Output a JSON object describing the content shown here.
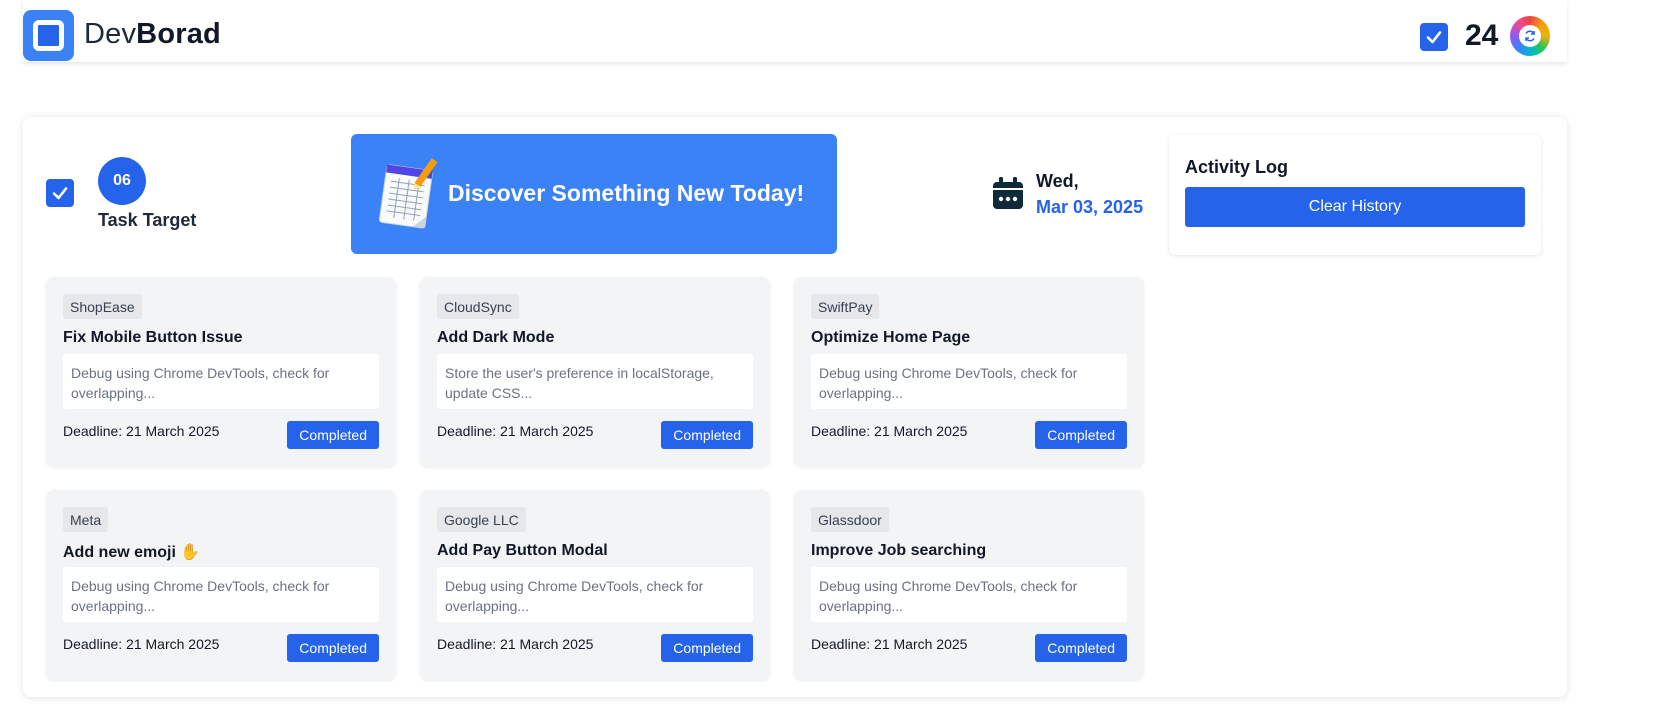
{
  "header": {
    "brand_prefix": "Dev",
    "brand_bold": "Borad",
    "completed_count": "24"
  },
  "task_target": {
    "count": "06",
    "label": "Task Target"
  },
  "banner": {
    "text": "Discover Something New Today!"
  },
  "date": {
    "day": "Wed,",
    "full": "Mar 03, 2025"
  },
  "activity_log": {
    "title": "Activity Log",
    "clear_label": "Clear History"
  },
  "cards": [
    {
      "company": "ShopEase",
      "title": "Fix Mobile Button Issue",
      "description": "Debug using Chrome DevTools, check for overlapping...",
      "deadline": "Deadline: 21 March 2025",
      "status": "Completed"
    },
    {
      "company": "CloudSync",
      "title": "Add Dark Mode",
      "description": "Store the user's preference in localStorage, update CSS...",
      "deadline": "Deadline: 21 March 2025",
      "status": "Completed"
    },
    {
      "company": "SwiftPay",
      "title": "Optimize Home Page",
      "description": "Debug using Chrome DevTools, check for overlapping...",
      "deadline": "Deadline: 21 March 2025",
      "status": "Completed"
    },
    {
      "company": "Meta",
      "title": "Add new emoji ✋",
      "description": "Debug using Chrome DevTools, check for overlapping...",
      "deadline": "Deadline: 21 March 2025",
      "status": "Completed"
    },
    {
      "company": "Google LLC",
      "title": "Add Pay Button Modal",
      "description": "Debug using Chrome DevTools, check for overlapping...",
      "deadline": "Deadline: 21 March 2025",
      "status": "Completed"
    },
    {
      "company": "Glassdoor",
      "title": "Improve Job searching",
      "description": "Debug using Chrome DevTools, check for overlapping...",
      "deadline": "Deadline: 21 March 2025",
      "status": "Completed"
    }
  ],
  "icons": {
    "logo": "logo-icon",
    "checkbox": "checkbox-checked-icon",
    "avatar": "refresh-avatar-icon",
    "banner": "notepad-pencil-icon",
    "calendar": "calendar-icon"
  },
  "colors": {
    "primary": "#2563eb",
    "banner": "#3b82f6",
    "card_bg": "#f3f4f6"
  }
}
